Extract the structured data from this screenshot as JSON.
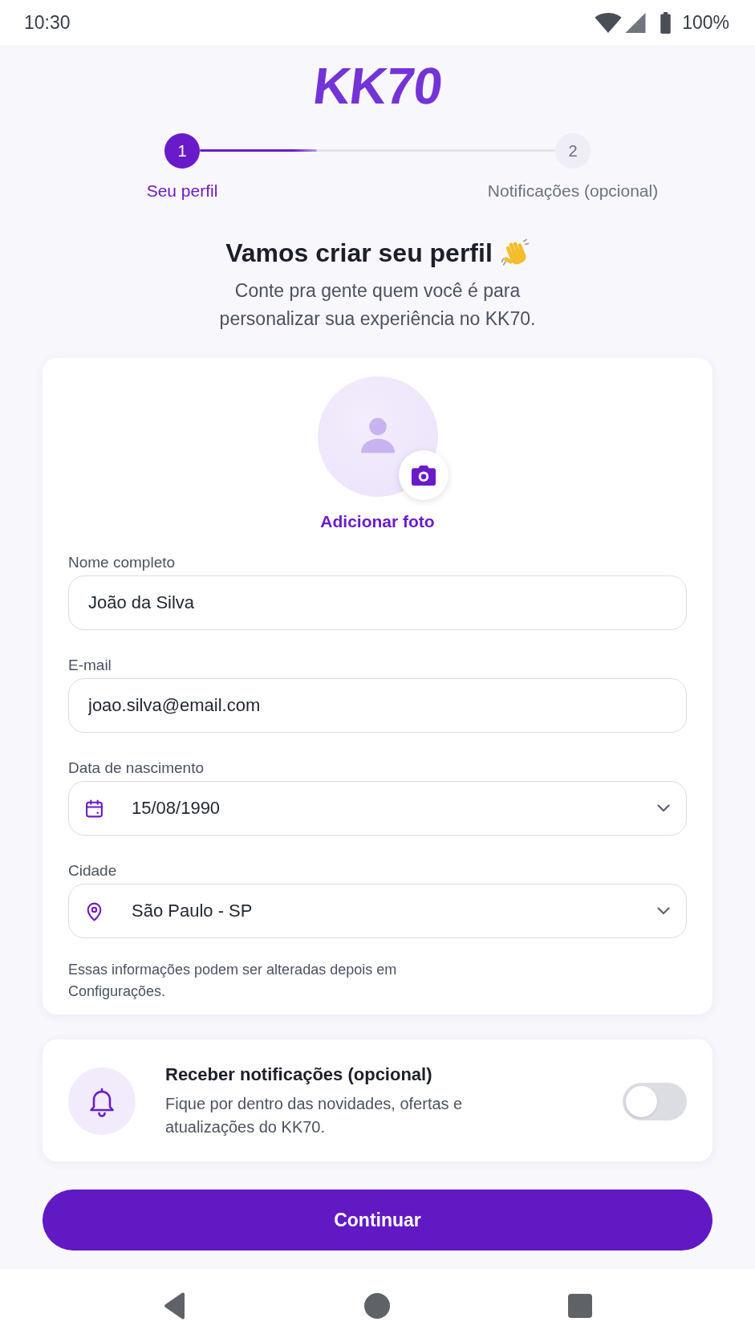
{
  "status_bar": {
    "time": "10:30",
    "battery": "100%"
  },
  "logo": {
    "text": "KK70"
  },
  "stepper": {
    "progress": {
      "level": 0.33
    },
    "steps": [
      {
        "number": "1",
        "label": "Seu perfil",
        "selected": true
      },
      {
        "number": "2",
        "label": "Notificações (opcional)",
        "selected": false
      }
    ]
  },
  "intro": {
    "title": "Vamos criar seu perfil",
    "subtitle": "Conte pra gente quem você é para personalizar sua experiência no KK70."
  },
  "profile": {
    "photo_action": "Adicionar foto",
    "fields": [
      {
        "kind": "text",
        "label": "Nome completo",
        "value": "João da Silva"
      },
      {
        "kind": "email",
        "label": "E-mail",
        "value": "joao.silva@email.com"
      },
      {
        "kind": "date",
        "label": "Data de nascimento",
        "value": "15/08/1990"
      },
      {
        "kind": "location",
        "label": "Cidade",
        "value": "São Paulo - SP"
      }
    ],
    "helper": "Essas informações podem ser alteradas depois em Configurações."
  },
  "notifications": {
    "title": "Receber notificações (opcional)",
    "description": "Fique por dentro das novidades, ofertas e atualizações do KK70.",
    "on": false
  },
  "primary_button": {
    "label": "Continuar"
  }
}
